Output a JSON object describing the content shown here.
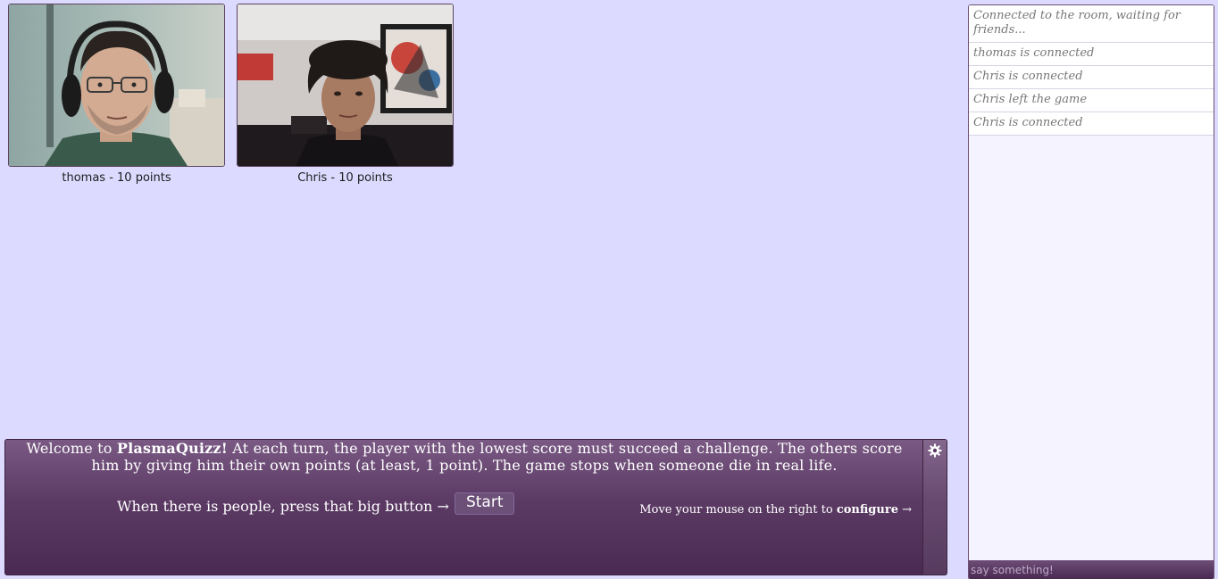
{
  "players": [
    {
      "name": "thomas",
      "score_label": "thomas - 10 points"
    },
    {
      "name": "Chris",
      "score_label": "Chris - 10 points"
    }
  ],
  "panel": {
    "welcome_prefix": "Welcome to ",
    "game_name": "PlasmaQuizz!",
    "welcome_rest": " At each turn, the player with the lowest score must succeed a challenge. The others score him by giving him their own points (at least, 1 point). The game stops when someone die in real life.",
    "start_prompt": "When there is people, press that big button →",
    "start_label": "Start",
    "configure_prefix": "Move your mouse on the right to ",
    "configure_word": "configure",
    "configure_arrow": " →"
  },
  "chat": {
    "messages": [
      "Connected to the room, waiting for friends...",
      "thomas is connected",
      "Chris is connected",
      "Chris left the game",
      "Chris is connected"
    ],
    "input_placeholder": "say something!"
  },
  "colors": {
    "background": "#dcdafe",
    "panel": "#5b3a64",
    "chat_background": "#f4f3ff"
  },
  "icons": {
    "settings": "gear-icon"
  }
}
